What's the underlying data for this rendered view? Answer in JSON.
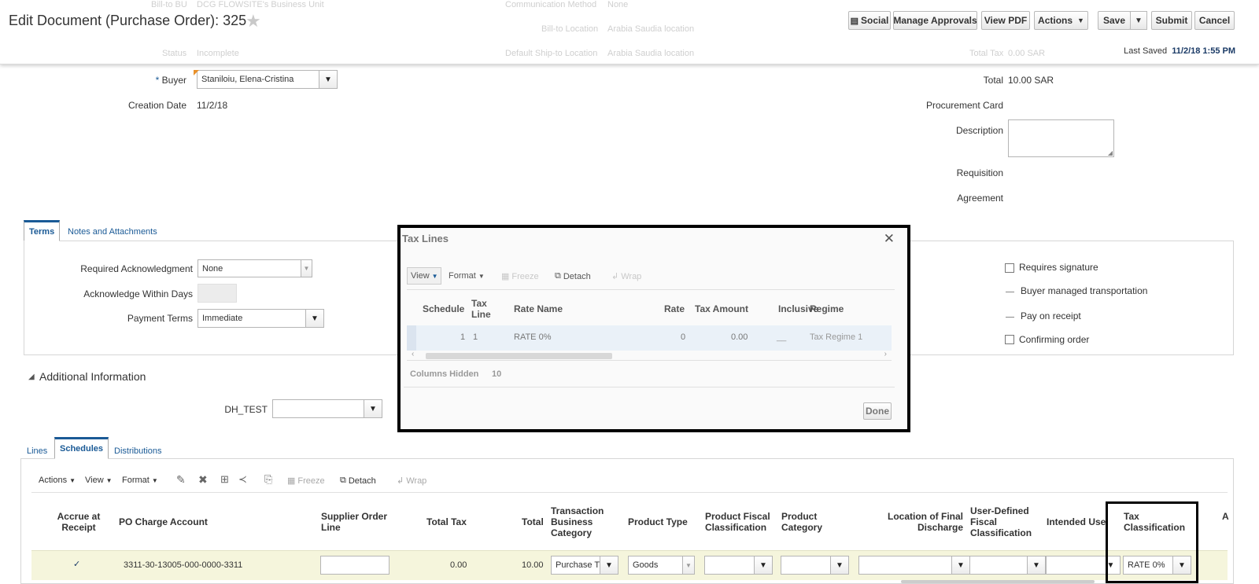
{
  "header": {
    "title": "Edit Document (Purchase Order): 325",
    "buttons": {
      "social": "Social",
      "manage_approvals": "Manage Approvals",
      "view_pdf": "View PDF",
      "actions": "Actions",
      "save": "Save",
      "submit": "Submit",
      "cancel": "Cancel"
    },
    "last_saved_label": "Last Saved",
    "last_saved_value": "11/2/18 1:55 PM",
    "ghost": {
      "bill_to_bu_label": "Bill-to BU",
      "bill_to_bu_value": "DCG FLOWSITE's Business Unit",
      "comm_method_label": "Communication Method",
      "comm_method_value": "None",
      "bill_to_location_label": "Bill-to Location",
      "bill_to_location_value": "Arabia Saudia location",
      "status_label": "Status",
      "status_value": "Incomplete",
      "ship_to_label": "Default Ship-to Location",
      "ship_to_value": "Arabia Saudia location",
      "total_tax_label": "Total Tax",
      "total_tax_value": "0.00 SAR"
    }
  },
  "form": {
    "buyer_label": "Buyer",
    "buyer_value": "Staniloiu, Elena-Cristina",
    "creation_date_label": "Creation Date",
    "creation_date_value": "11/2/18",
    "total_label": "Total",
    "total_value": "10.00",
    "total_currency": "SAR",
    "procurement_card_label": "Procurement Card",
    "description_label": "Description",
    "requisition_label": "Requisition",
    "agreement_label": "Agreement"
  },
  "terms": {
    "tabs": [
      "Terms",
      "Notes and Attachments"
    ],
    "required_ack_label": "Required Acknowledgment",
    "required_ack_value": "None",
    "ack_within_days_label": "Acknowledge Within Days",
    "payment_terms_label": "Payment Terms",
    "payment_terms_value": "Immediate",
    "requires_signature": "Requires signature",
    "buyer_managed_transport": "Buyer managed transportation",
    "pay_on_receipt": "Pay on receipt",
    "confirming_order": "Confirming order"
  },
  "additional": {
    "title": "Additional Information",
    "dh_test_label": "DH_TEST"
  },
  "lines": {
    "tabs": [
      "Lines",
      "Schedules",
      "Distributions"
    ],
    "toolbar": {
      "actions": "Actions",
      "view": "View",
      "format": "Format",
      "freeze": "Freeze",
      "detach": "Detach",
      "wrap": "Wrap"
    },
    "columns": {
      "accrue": "Accrue at Receipt",
      "po_charge": "PO Charge Account",
      "supplier_order_line": "Supplier Order Line",
      "total_tax": "Total Tax",
      "total": "Total",
      "tbc": "Transaction Business Category",
      "product_type": "Product Type",
      "pfc": "Product Fiscal Classification",
      "product_category": "Product Category",
      "lfd": "Location of Final Discharge",
      "udfc": "User-Defined Fiscal Classification",
      "intended_use": "Intended Use",
      "tax_classification": "Tax Classification",
      "last_partial": "A"
    },
    "row": {
      "accrue": "✓",
      "po_charge": "3311-30-13005-000-0000-3311",
      "total_tax": "0.00",
      "total": "10.00",
      "tbc": "Purchase Tr",
      "product_type": "Goods",
      "tax_classification": "RATE 0%"
    }
  },
  "modal": {
    "title": "Tax Lines",
    "toolbar": {
      "view": "View",
      "format": "Format",
      "freeze": "Freeze",
      "detach": "Detach",
      "wrap": "Wrap"
    },
    "columns": {
      "schedule": "Schedule",
      "tax_line": "Tax Line",
      "rate_name": "Rate Name",
      "rate": "Rate",
      "tax_amount": "Tax Amount",
      "inclusive": "Inclusive",
      "regime": "Regime"
    },
    "row": {
      "schedule": "1",
      "tax_line": "1",
      "rate_name": "RATE 0%",
      "rate": "0",
      "tax_amount": "0.00",
      "inclusive": "__",
      "regime": "Tax Regime 1"
    },
    "columns_hidden_label": "Columns Hidden",
    "columns_hidden_value": "10",
    "done": "Done"
  }
}
